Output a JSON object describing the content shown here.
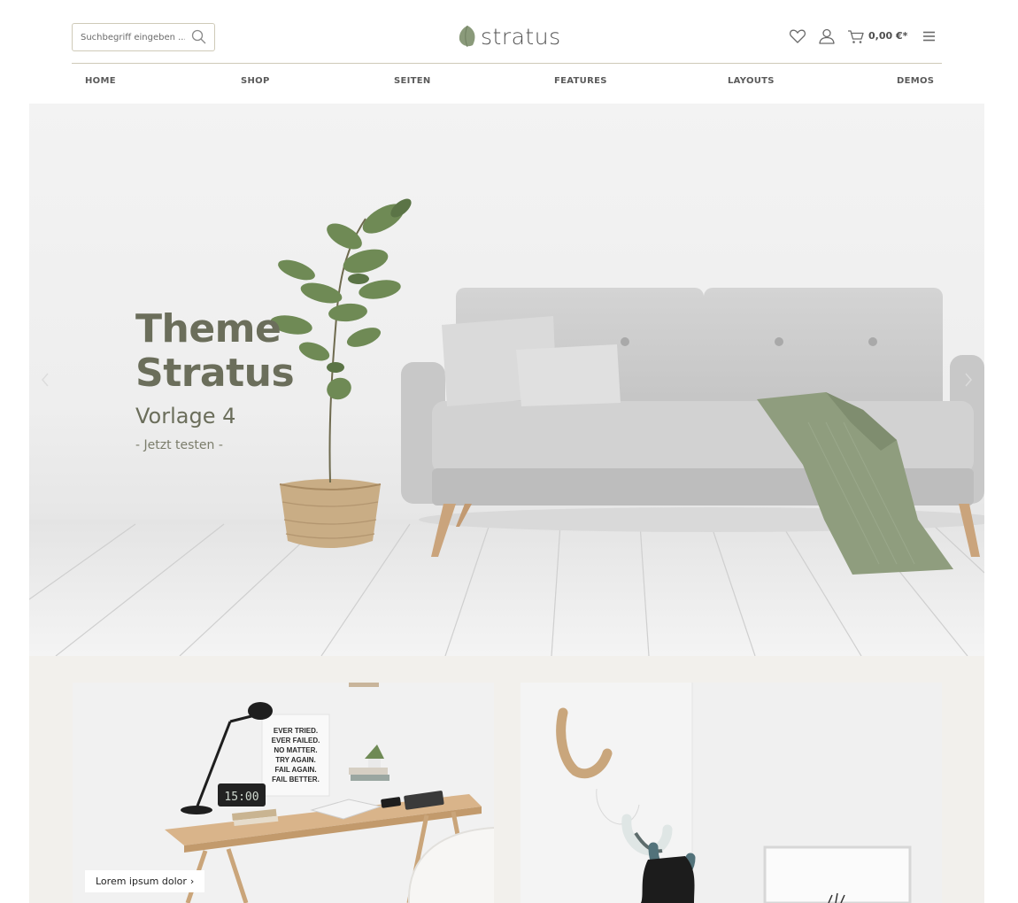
{
  "header": {
    "search": {
      "placeholder": "Suchbegriff eingeben ..."
    },
    "logo": {
      "text": "stratus"
    },
    "cart": {
      "total": "0,00 €*"
    }
  },
  "nav": {
    "items": [
      {
        "label": "HOME"
      },
      {
        "label": "SHOP"
      },
      {
        "label": "SEITEN"
      },
      {
        "label": "FEATURES"
      },
      {
        "label": "LAYOUTS"
      },
      {
        "label": "DEMOS"
      }
    ]
  },
  "hero": {
    "title": "Theme\nStratus",
    "subtitle": "Vorlage 4",
    "cta": "- Jetzt testen -"
  },
  "tiles": [
    {
      "label": "Lorem ipsum dolor",
      "poster_lines": [
        "EVER TRIED.",
        "EVER FAILED.",
        "NO MATTER.",
        "TRY AGAIN.",
        "FAIL AGAIN.",
        "FAIL BETTER."
      ],
      "clock": "15:00"
    },
    {
      "label": ""
    }
  ],
  "colors": {
    "accent_green": "#6b6e5b",
    "sage": "#8a9a7a",
    "lower_background": "#f2f0ec",
    "border_beige": "#cfcab8"
  },
  "icons": [
    "search-icon",
    "leaf-logo-icon",
    "heart-icon",
    "user-icon",
    "cart-icon",
    "menu-icon",
    "chevron-left-icon",
    "chevron-right-icon",
    "chevron-right-small-icon"
  ]
}
